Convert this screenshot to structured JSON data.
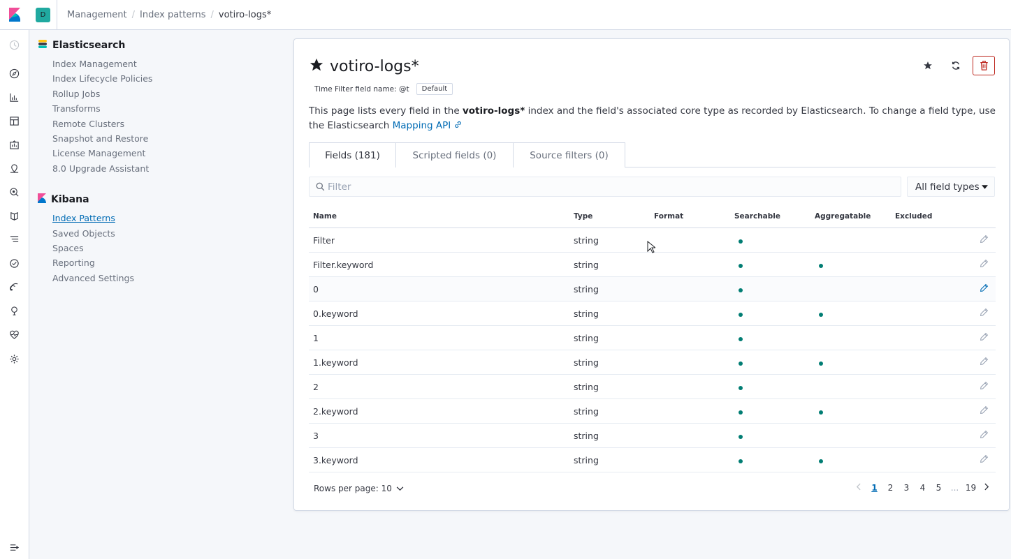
{
  "header": {
    "space_initial": "D",
    "breadcrumbs": [
      "Management",
      "Index patterns",
      "votiro-logs*"
    ]
  },
  "sidebar": {
    "sections": [
      {
        "title": "Elasticsearch",
        "items": [
          "Index Management",
          "Index Lifecycle Policies",
          "Rollup Jobs",
          "Transforms",
          "Remote Clusters",
          "Snapshot and Restore",
          "License Management",
          "8.0 Upgrade Assistant"
        ]
      },
      {
        "title": "Kibana",
        "items": [
          "Index Patterns",
          "Saved Objects",
          "Spaces",
          "Reporting",
          "Advanced Settings"
        ],
        "active": "Index Patterns"
      }
    ]
  },
  "main": {
    "title": "votiro-logs*",
    "time_filter_label": "Time Filter field name: @t",
    "default_badge": "Default",
    "desc_prefix": "This page lists every field in the ",
    "desc_index": "votiro-logs*",
    "desc_suffix": " index and the field's associated core type as recorded by Elasticsearch. To change a field type, use the Elasticsearch ",
    "desc_link": "Mapping API",
    "tabs": [
      "Fields (181)",
      "Scripted fields (0)",
      "Source filters (0)"
    ],
    "filter_placeholder": "Filter",
    "field_type_select": "All field types",
    "columns": {
      "name": "Name",
      "type": "Type",
      "format": "Format",
      "searchable": "Searchable",
      "aggregatable": "Aggregatable",
      "excluded": "Excluded"
    },
    "rows": [
      {
        "name": "Filter",
        "type": "string",
        "searchable": true,
        "aggregatable": false
      },
      {
        "name": "Filter.keyword",
        "type": "string",
        "searchable": true,
        "aggregatable": true
      },
      {
        "name": "0",
        "type": "string",
        "searchable": true,
        "aggregatable": false
      },
      {
        "name": "0.keyword",
        "type": "string",
        "searchable": true,
        "aggregatable": true
      },
      {
        "name": "1",
        "type": "string",
        "searchable": true,
        "aggregatable": false
      },
      {
        "name": "1.keyword",
        "type": "string",
        "searchable": true,
        "aggregatable": true
      },
      {
        "name": "2",
        "type": "string",
        "searchable": true,
        "aggregatable": false
      },
      {
        "name": "2.keyword",
        "type": "string",
        "searchable": true,
        "aggregatable": true
      },
      {
        "name": "3",
        "type": "string",
        "searchable": true,
        "aggregatable": false
      },
      {
        "name": "3.keyword",
        "type": "string",
        "searchable": true,
        "aggregatable": true
      }
    ],
    "rows_per_page": "Rows per page: 10",
    "pagination": {
      "pages": [
        "1",
        "2",
        "3",
        "4",
        "5",
        "...",
        "19"
      ],
      "current": "1"
    }
  },
  "colors": {
    "accent": "#006bb4",
    "dot": "#017d73",
    "danger": "#bd271e",
    "space_badge": "#20a9a0"
  }
}
